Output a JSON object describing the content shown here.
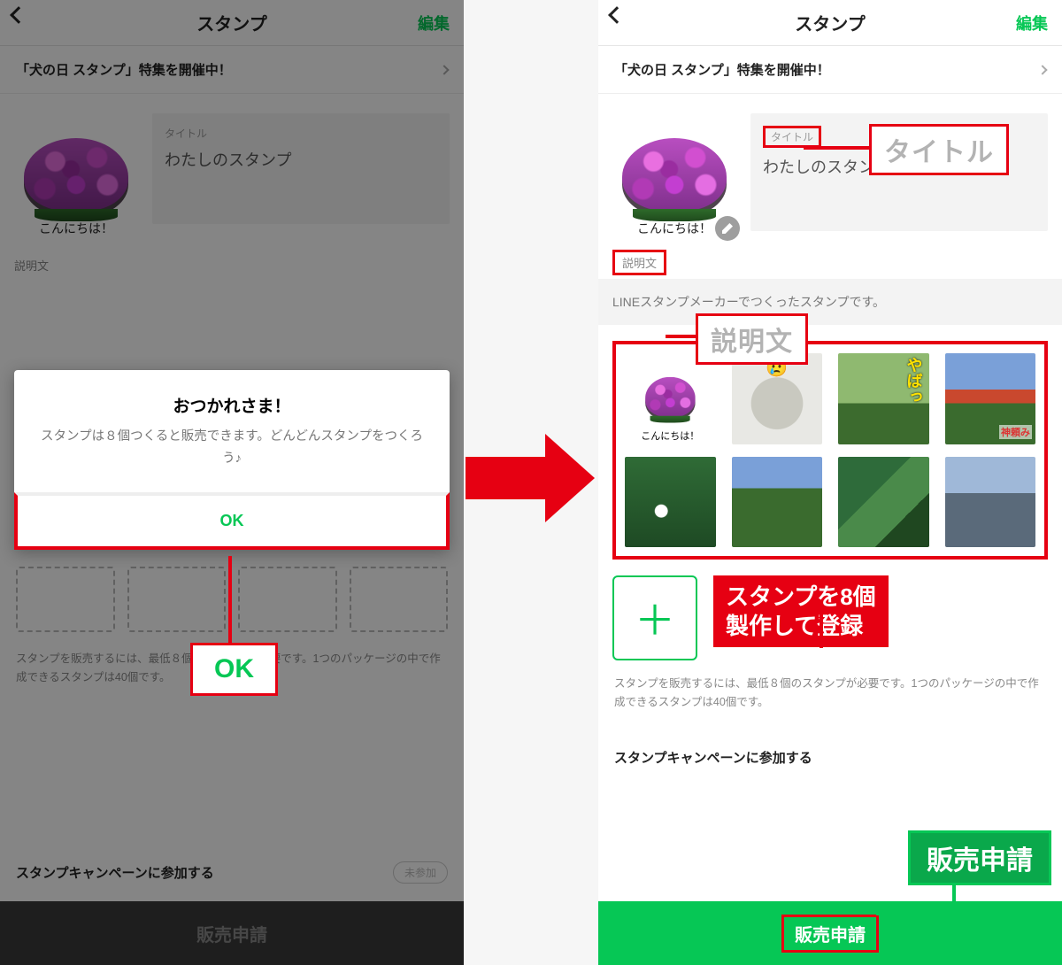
{
  "header": {
    "title": "スタンプ",
    "edit": "編集"
  },
  "banner": "「犬の日 スタンプ」特集を開催中！",
  "stamp": {
    "title_label": "タイトル",
    "title_value": "わたしのスタンプ",
    "caption": "こんにちは！"
  },
  "desc": {
    "label": "説明文",
    "value": "LINEスタンプメーカーでつくったスタンプです。"
  },
  "grid_tags": {
    "yaba": "やばっ",
    "shrine": "神頼み"
  },
  "note": "スタンプを販売するには、最低８個のスタンプが必要です。1つのパッケージの中で作成できるスタンプは40個です。",
  "campaign": {
    "text": "スタンプキャンペーンに参加する",
    "pill": "未参加"
  },
  "footer": "販売申請",
  "modal": {
    "title": "おつかれさま！",
    "body": "スタンプは８個つくると販売できます。どんどんスタンプをつくろう♪",
    "ok": "OK"
  },
  "ann": {
    "ok": "OK",
    "title": "タイトル",
    "desc": "説明文",
    "make8": "スタンプを8個\n製作して登録",
    "apply": "販売申請"
  }
}
